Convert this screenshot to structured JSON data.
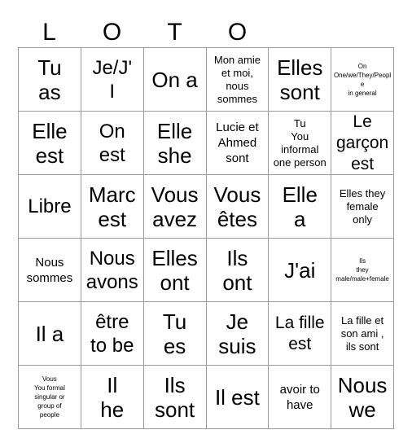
{
  "header": {
    "title_letters": [
      "L",
      "O",
      "T",
      "O",
      "",
      ""
    ]
  },
  "grid": {
    "columns": 6,
    "rows": 6,
    "border_color": "#9a9a9a",
    "background_color": "#ffffff",
    "text_color": "#000000",
    "cells": [
      {
        "text": "Tu\nas",
        "size": "fs-xl"
      },
      {
        "text": "Je/J'\nI",
        "size": "fs-lg"
      },
      {
        "text": "On a",
        "size": "fs-xl"
      },
      {
        "text": "Mon amie\net moi,\nnous\nsommes",
        "size": "fs-xs"
      },
      {
        "text": "Elles\nsont",
        "size": "fs-xl"
      },
      {
        "text": "On\nOne/we/They/People\nin general",
        "size": "fs-xxs"
      },
      {
        "text": "Elle\nest",
        "size": "fs-xl"
      },
      {
        "text": "On\nest",
        "size": "fs-lg"
      },
      {
        "text": "Elle\nshe",
        "size": "fs-xl"
      },
      {
        "text": "Lucie et\nAhmed\nsont",
        "size": "fs-sm"
      },
      {
        "text": "Tu\nYou\ninformal\none person",
        "size": "fs-xs"
      },
      {
        "text": "Le\ngarçon\nest",
        "size": "fs-md"
      },
      {
        "text": "Libre",
        "size": "fs-lg"
      },
      {
        "text": "Marc\nest",
        "size": "fs-xl"
      },
      {
        "text": "Vous\navez",
        "size": "fs-xl"
      },
      {
        "text": "Vous\nêtes",
        "size": "fs-xl"
      },
      {
        "text": "Elle\na",
        "size": "fs-xl"
      },
      {
        "text": "Elles they\nfemale\nonly",
        "size": "fs-xs"
      },
      {
        "text": "Nous\nsommes",
        "size": "fs-sm"
      },
      {
        "text": "Nous\navons",
        "size": "fs-lg"
      },
      {
        "text": "Elles\nont",
        "size": "fs-xl"
      },
      {
        "text": "Ils\nont",
        "size": "fs-xl"
      },
      {
        "text": "J'ai",
        "size": "fs-xl"
      },
      {
        "text": "Ils\nthey\nmale/male+female",
        "size": "fs-xxs"
      },
      {
        "text": "Il a",
        "size": "fs-xl"
      },
      {
        "text": "être\nto be",
        "size": "fs-lg"
      },
      {
        "text": "Tu\nes",
        "size": "fs-xl"
      },
      {
        "text": "Je\nsuis",
        "size": "fs-xl"
      },
      {
        "text": "La fille\nest",
        "size": "fs-md"
      },
      {
        "text": "La fille et\nson ami ,\nils sont",
        "size": "fs-xs"
      },
      {
        "text": "Vous\nYou formal\nsingular or\ngroup of\npeople",
        "size": "fs-xxs"
      },
      {
        "text": "Il\nhe",
        "size": "fs-xl"
      },
      {
        "text": "Ils\nsont",
        "size": "fs-xl"
      },
      {
        "text": "Il est",
        "size": "fs-xl"
      },
      {
        "text": "avoir to\nhave",
        "size": "fs-sm"
      },
      {
        "text": "Nous\nwe",
        "size": "fs-xl"
      }
    ]
  }
}
